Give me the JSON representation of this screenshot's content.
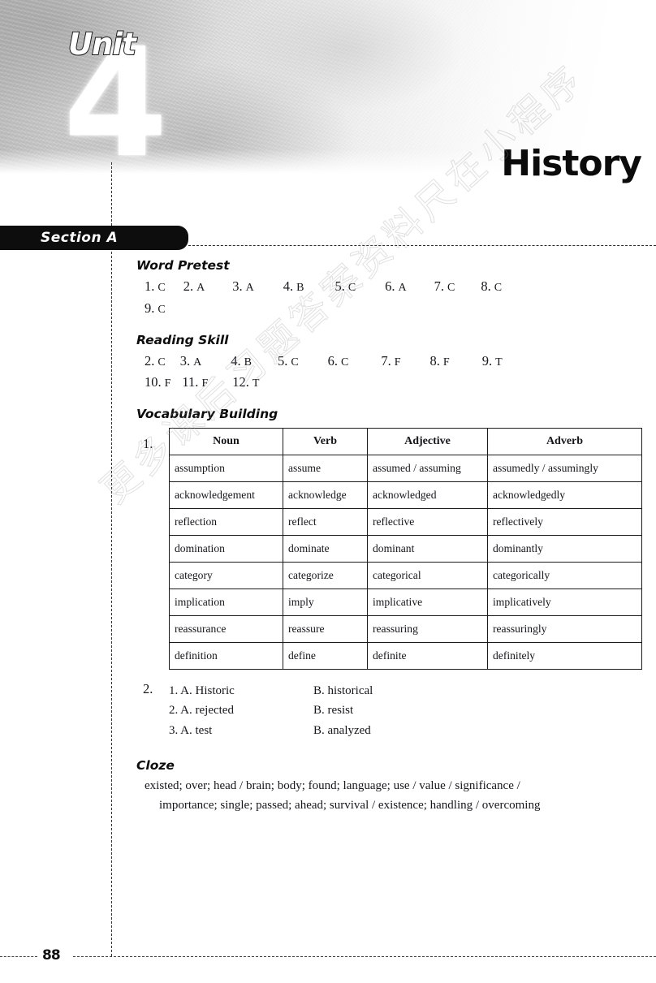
{
  "header": {
    "unit_word": "Unit",
    "unit_number": "4",
    "unit_title": "History",
    "section_label": "Section  A"
  },
  "sections": {
    "word_pretest": {
      "heading": "Word  Pretest",
      "answers": [
        {
          "n": "1.",
          "v": "C"
        },
        {
          "n": "2.",
          "v": "A"
        },
        {
          "n": "3.",
          "v": "A"
        },
        {
          "n": "4.",
          "v": "B"
        },
        {
          "n": "5.",
          "v": "C"
        },
        {
          "n": "6.",
          "v": "A"
        },
        {
          "n": "7.",
          "v": "C"
        },
        {
          "n": "8.",
          "v": "C"
        },
        {
          "n": "9.",
          "v": "C"
        }
      ]
    },
    "reading_skill": {
      "heading": "Reading Skill",
      "answers": [
        {
          "n": "2.",
          "v": "C"
        },
        {
          "n": "3.",
          "v": "A"
        },
        {
          "n": "4.",
          "v": "B"
        },
        {
          "n": "5.",
          "v": "C"
        },
        {
          "n": "6.",
          "v": "C"
        },
        {
          "n": "7.",
          "v": "F"
        },
        {
          "n": "8.",
          "v": "F"
        },
        {
          "n": "9.",
          "v": "T"
        },
        {
          "n": "10.",
          "v": "F"
        },
        {
          "n": "11.",
          "v": "F"
        },
        {
          "n": "12.",
          "v": "T"
        }
      ]
    },
    "vocabulary_building": {
      "heading": "Vocabulary Building",
      "item1_index": "1.",
      "table": {
        "columns": [
          "Noun",
          "Verb",
          "Adjective",
          "Adverb"
        ],
        "rows": [
          [
            "assumption",
            "assume",
            "assumed / assuming",
            "assumedly / assumingly"
          ],
          [
            "acknowledgement",
            "acknowledge",
            "acknowledged",
            "acknowledgedly"
          ],
          [
            "reflection",
            "reflect",
            "reflective",
            "reflectively"
          ],
          [
            "domination",
            "dominate",
            "dominant",
            "dominantly"
          ],
          [
            "category",
            "categorize",
            "categorical",
            "categorically"
          ],
          [
            "implication",
            "imply",
            "implicative",
            "implicatively"
          ],
          [
            "reassurance",
            "reassure",
            "reassuring",
            "reassuringly"
          ],
          [
            "definition",
            "define",
            "definite",
            "definitely"
          ]
        ]
      },
      "item2_index": "2.",
      "item2_rows": [
        {
          "a": "1. A. Historic",
          "b": "B. historical"
        },
        {
          "a": "2. A. rejected",
          "b": "B. resist"
        },
        {
          "a": "3. A. test",
          "b": "B. analyzed"
        }
      ]
    },
    "cloze": {
      "heading": "Cloze",
      "line1": "existed; over; head / brain; body; found; language; use / value / significance /",
      "line2": "importance; single; passed; ahead; survival / existence; handling / overcoming"
    }
  },
  "footer": {
    "page_number": "88"
  },
  "watermark": {
    "text": "更多课后习题答案资料尺在小程序"
  }
}
